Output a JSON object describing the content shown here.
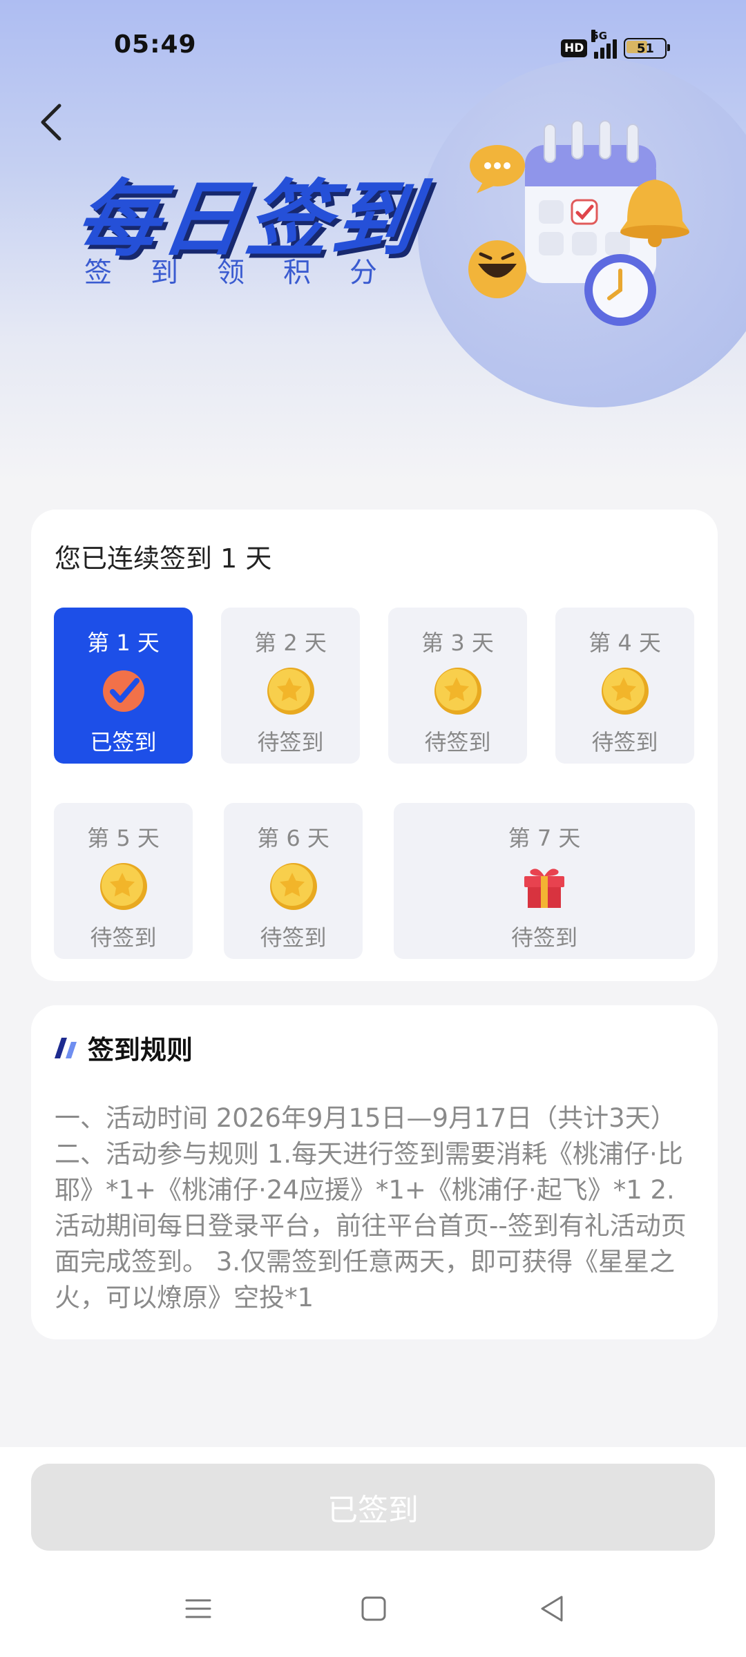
{
  "status_bar": {
    "time": "05:49",
    "hd": "HD",
    "network": "5G",
    "battery": "51"
  },
  "header": {
    "title": "每日签到",
    "subtitle": "签到领积分"
  },
  "streak": {
    "text": "您已连续签到 1 天"
  },
  "days": [
    {
      "label": "第 1 天",
      "status": "已签到",
      "icon": "check-icon"
    },
    {
      "label": "第 2 天",
      "status": "待签到",
      "icon": "star-coin-icon"
    },
    {
      "label": "第 3 天",
      "status": "待签到",
      "icon": "star-coin-icon"
    },
    {
      "label": "第 4 天",
      "status": "待签到",
      "icon": "star-coin-icon"
    },
    {
      "label": "第 5 天",
      "status": "待签到",
      "icon": "star-coin-icon"
    },
    {
      "label": "第 6 天",
      "status": "待签到",
      "icon": "star-coin-icon"
    },
    {
      "label": "第 7 天",
      "status": "待签到",
      "icon": "gift-icon"
    }
  ],
  "rules": {
    "title": "签到规则",
    "text": "一、活动时间 2026年9月15日—9月17日（共计3天）二、活动参与规则 1.每天进行签到需要消耗《桃浦仔·比耶》*1+《桃浦仔·24应援》*1+《桃浦仔·起飞》*1 2. 活动期间每日登录平台，前往平台首页--签到有礼活动页面完成签到。 3.仅需签到任意两天，即可获得《星星之火，可以燎原》空投*1"
  },
  "button": {
    "label": "已签到"
  },
  "colors": {
    "accent": "#1d4fe8",
    "coin": "#f5c842",
    "gift": "#e8424f"
  }
}
